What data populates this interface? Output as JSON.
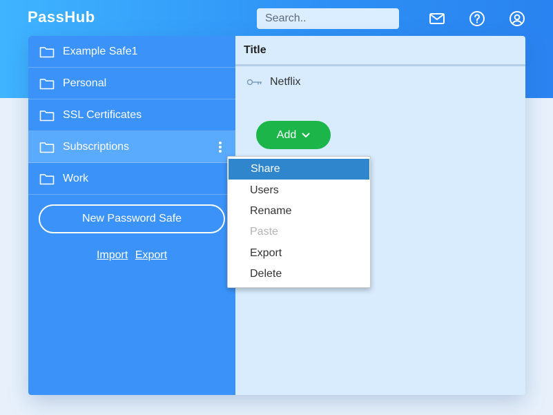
{
  "app": {
    "logo": "PassHub"
  },
  "header": {
    "search": {
      "placeholder": "Search.."
    },
    "icons": [
      "mail-icon",
      "help-icon",
      "account-icon"
    ]
  },
  "sidebar": {
    "safes": [
      {
        "label": "Example Safe1",
        "active": false
      },
      {
        "label": "Personal",
        "active": false
      },
      {
        "label": "SSL Certificates",
        "active": false
      },
      {
        "label": "Subscriptions",
        "active": true
      },
      {
        "label": "Work",
        "active": false
      }
    ],
    "new_safe_label": "New Password Safe",
    "import_label": "Import",
    "export_label": "Export"
  },
  "main": {
    "column_title": "Title",
    "items": [
      {
        "title": "Netflix",
        "icon": "key-icon"
      }
    ],
    "add_label": "Add"
  },
  "context_menu": {
    "items": [
      {
        "label": "Share",
        "state": "highlighted"
      },
      {
        "label": "Users",
        "state": "normal"
      },
      {
        "label": "Rename",
        "state": "normal"
      },
      {
        "label": "Paste",
        "state": "disabled"
      },
      {
        "label": "Export",
        "state": "normal"
      },
      {
        "label": "Delete",
        "state": "normal"
      }
    ]
  },
  "colors": {
    "header_gradient_start": "#3fb4ff",
    "header_gradient_end": "#2a83f0",
    "sidebar_bg": "#3b93fa",
    "sidebar_active": "#5aaafd",
    "content_bg": "#d8ecfd",
    "add_button": "#1bb54a",
    "menu_highlight": "#2f86cc"
  }
}
